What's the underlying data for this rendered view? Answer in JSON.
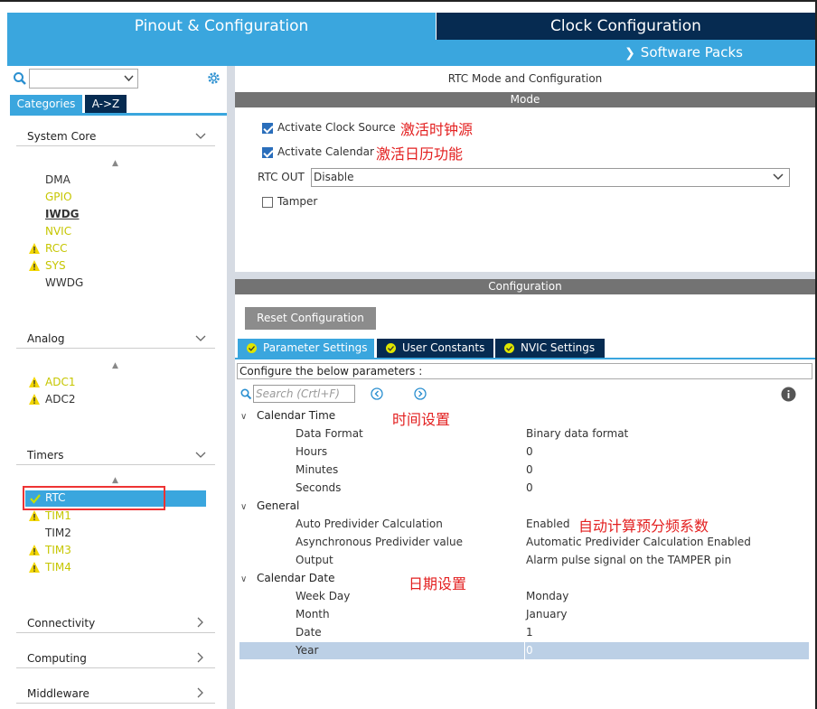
{
  "header": {
    "tab_pinout": "Pinout & Configuration",
    "tab_clock": "Clock Configuration",
    "software_packs": "Software Packs"
  },
  "left": {
    "tab_categories": "Categories",
    "tab_az": "A->Z",
    "sections": {
      "system_core": "System Core",
      "analog": "Analog",
      "timers": "Timers",
      "connectivity": "Connectivity",
      "computing": "Computing",
      "middleware": "Middleware"
    },
    "system_core_items": [
      "DMA",
      "GPIO",
      "IWDG",
      "NVIC",
      "RCC",
      "SYS",
      "WWDG"
    ],
    "analog_items": [
      "ADC1",
      "ADC2"
    ],
    "timers_items": [
      "RTC",
      "TIM1",
      "TIM2",
      "TIM3",
      "TIM4"
    ]
  },
  "right": {
    "title": "RTC Mode and Configuration",
    "mode_bar": "Mode",
    "activate_clock": "Activate Clock Source",
    "activate_clock_note": "激活时钟源",
    "activate_calendar": "Activate Calendar",
    "activate_calendar_note": "激活日历功能",
    "rtc_out_label": "RTC OUT",
    "rtc_out_value": "Disable",
    "tamper": "Tamper",
    "config_bar": "Configuration",
    "reset_button": "Reset Configuration",
    "tab_param": "Parameter Settings",
    "tab_user": "User Constants",
    "tab_nvic": "NVIC Settings",
    "cfg_desc": "Configure the below parameters :",
    "search_placeholder": "Search (Crtl+F)",
    "groups": {
      "calendar_time": "Calendar Time",
      "general": "General",
      "calendar_date": "Calendar Date"
    },
    "notes": {
      "time": "时间设置",
      "auto": "自动计算预分频系数",
      "date": "日期设置"
    },
    "params": {
      "data_format": {
        "name": "Data Format",
        "value": "Binary data format"
      },
      "hours": {
        "name": "Hours",
        "value": "0"
      },
      "minutes": {
        "name": "Minutes",
        "value": "0"
      },
      "seconds": {
        "name": "Seconds",
        "value": "0"
      },
      "auto_pred": {
        "name": "Auto Predivider Calculation",
        "value": "Enabled"
      },
      "async_pred": {
        "name": "Asynchronous Predivider value",
        "value": "Automatic Predivider Calculation Enabled"
      },
      "output": {
        "name": "Output",
        "value": "Alarm pulse signal on the TAMPER pin"
      },
      "week_day": {
        "name": "Week Day",
        "value": "Monday"
      },
      "month": {
        "name": "Month",
        "value": "January"
      },
      "date": {
        "name": "Date",
        "value": "1"
      },
      "year": {
        "name": "Year",
        "value": "0"
      }
    }
  },
  "colors": {
    "accent": "#3aa6de",
    "dark": "#062b51",
    "warning": "#f2d600",
    "annotation": "#e32020"
  }
}
